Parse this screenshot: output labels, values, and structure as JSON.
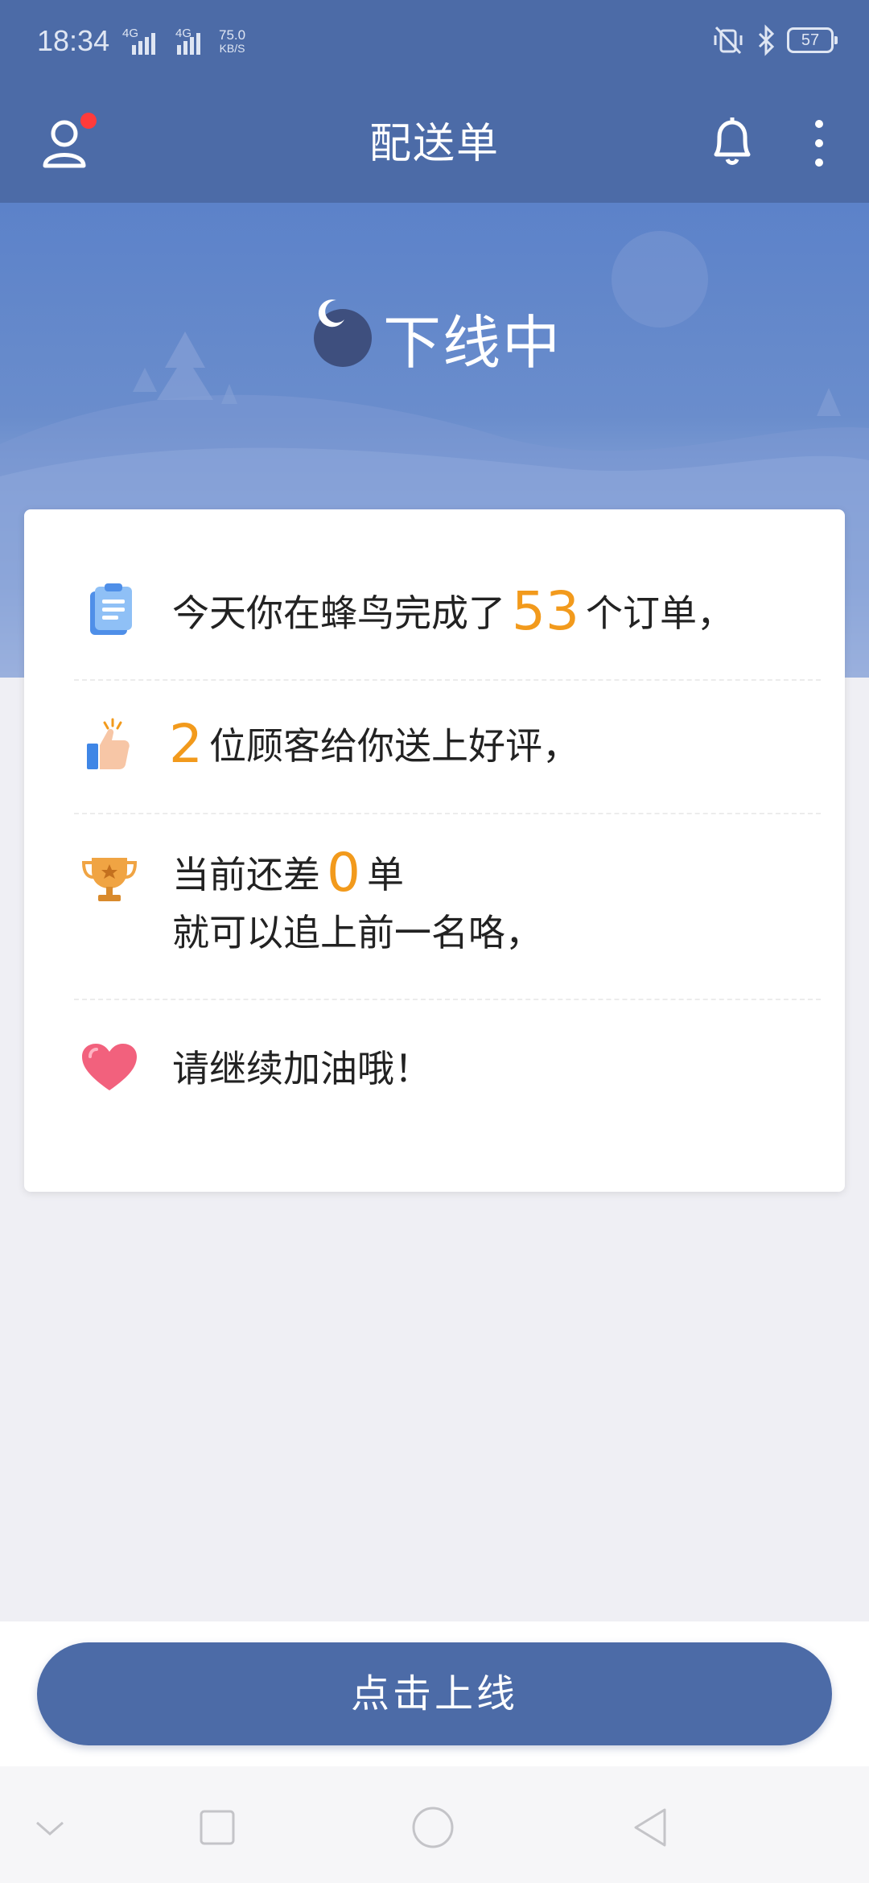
{
  "status_bar": {
    "time": "18:34",
    "signal1": "4G",
    "signal2": "4G",
    "speed_value": "75.0",
    "speed_unit": "KB/S",
    "battery": "57",
    "icons": [
      "vibrate-off-icon",
      "bluetooth-icon",
      "battery-icon"
    ]
  },
  "header": {
    "title": "配送单",
    "left_icon": "user-profile-icon",
    "right_icons": [
      "bell-icon",
      "more-vertical-icon"
    ]
  },
  "status": {
    "text": "下线中",
    "icon": "moon-icon"
  },
  "card": {
    "row1": {
      "icon": "clipboard-icon",
      "pre": "今天你在蜂鸟完成了",
      "number": "53",
      "post": "个订单，"
    },
    "row2": {
      "icon": "thumbs-up-icon",
      "number": "2",
      "post": "位顾客给你送上好评，"
    },
    "row3": {
      "icon": "trophy-icon",
      "pre": "当前还差",
      "number": "0",
      "post": "单",
      "line2": "就可以追上前一名咯，"
    },
    "row4": {
      "icon": "heart-icon",
      "text": "请继续加油哦！"
    }
  },
  "online_button": {
    "label": "点击上线"
  },
  "nav": {
    "icons": [
      "chevron-down-icon",
      "square-icon",
      "circle-home-icon",
      "triangle-back-icon"
    ]
  },
  "colors": {
    "primary": "#4c6ba7",
    "accent_number": "#f29a1c",
    "background": "#efeff4"
  }
}
